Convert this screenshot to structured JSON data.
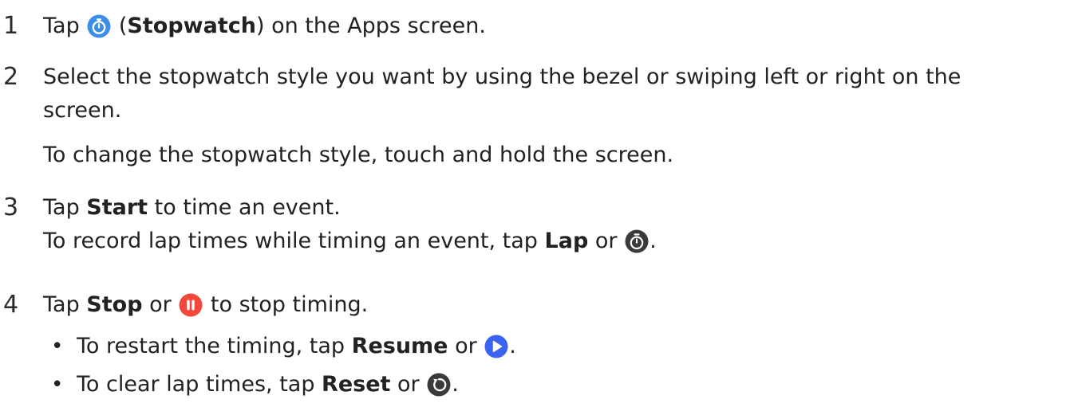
{
  "steps": [
    {
      "number": "1",
      "lines": [
        {
          "before": "Tap ",
          "icon": "stopwatch-app-icon",
          "after_icon": " (",
          "bold": "Stopwatch",
          "after": ") on the Apps screen."
        }
      ]
    },
    {
      "number": "2",
      "lines": [
        {
          "text": "Select the stopwatch style you want by using the bezel or swiping left or right on the"
        },
        {
          "text": "screen."
        },
        {
          "text": "To change the stopwatch style, touch and hold the screen."
        }
      ]
    },
    {
      "number": "3",
      "lines": [
        {
          "before": "Tap ",
          "bold": "Start",
          "after": " to time an event."
        },
        {
          "before": "To record lap times while timing an event, tap ",
          "bold": "Lap",
          "middle": " or ",
          "icon": "lap-icon",
          "after": "."
        }
      ]
    },
    {
      "number": "4",
      "lines": [
        {
          "before": "Tap ",
          "bold": "Stop",
          "middle": " or ",
          "icon": "pause-icon",
          "after": " to stop timing."
        }
      ],
      "bullets": [
        {
          "bullet": "•",
          "before": "To restart the timing, tap ",
          "bold": "Resume",
          "middle": " or ",
          "icon": "play-icon",
          "after": "."
        },
        {
          "bullet": "•",
          "before": "To clear lap times, tap ",
          "bold": "Reset",
          "middle": " or ",
          "icon": "reset-icon",
          "after": "."
        }
      ]
    }
  ],
  "colors": {
    "text": "#222222",
    "stopwatch_icon_bg": "#3d8ee8",
    "lap_icon_bg": "#3a3a3a",
    "pause_icon_bg": "#f2473a",
    "play_icon_bg": "#3a63f0",
    "reset_icon_bg": "#3a3a3a"
  }
}
